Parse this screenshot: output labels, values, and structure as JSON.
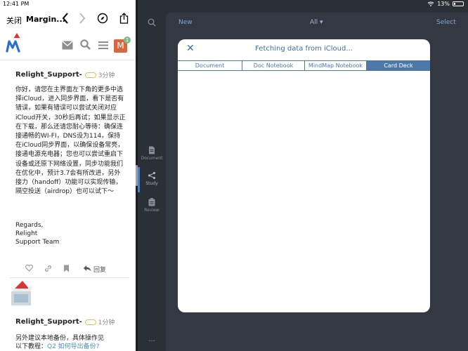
{
  "status": {
    "time": "12:41 PM",
    "battery": "13%"
  },
  "browser": {
    "close": "关闭",
    "title": "Margin..."
  },
  "forum": {
    "avatar_letter": "M",
    "notification_count": "1"
  },
  "post1": {
    "user": "Relight_Support-",
    "ago": "3分钟",
    "body": "你好，请您在主界面左下角的更多中选择iCloud，进入同步界面，看下是否有错误，如果有错误可以尝试关闭对应iCloud开关，30秒后再试；如果显示正在下载，那么还请您耐心等待：确保连接通畅的WI-FI，DNS设为114，保持在iCloud同步界面，以确保设备常亮，接通电源充电器；您也可以尝试重启下设备或还原下网络设置，同步功能我们在优化中，预计3.7会有所改进，另外接力（handoff）功能可以实现传输，隔空投送（airdrop）也可以试下～",
    "sig": [
      "Regards,",
      "Relight",
      "Support Team"
    ],
    "reply": "回复"
  },
  "post2": {
    "user": "Relight_Support-",
    "ago": "1分钟",
    "line1": "另外建议本地备份，具体操作见",
    "line2_prefix": "以下教程：",
    "line2_link": "Q2 如何导出备份?"
  },
  "marginnote": {
    "toolbar": {
      "new": "New",
      "all": "All ▾",
      "select": "Select"
    },
    "sidebar": [
      {
        "label": "Document"
      },
      {
        "label": "Study"
      },
      {
        "label": "Review"
      }
    ],
    "modal": {
      "title": "Fetching data from iCloud...",
      "tabs": [
        "Document",
        "Doc Notebook",
        "MindMap Notebook",
        "Card Deck"
      ],
      "active_tab": "Card Deck"
    },
    "more": "..."
  },
  "colors": {
    "accent": "#4e78a8",
    "sidebar_bg": "#2b2f36",
    "avatar": "#d9673d"
  }
}
